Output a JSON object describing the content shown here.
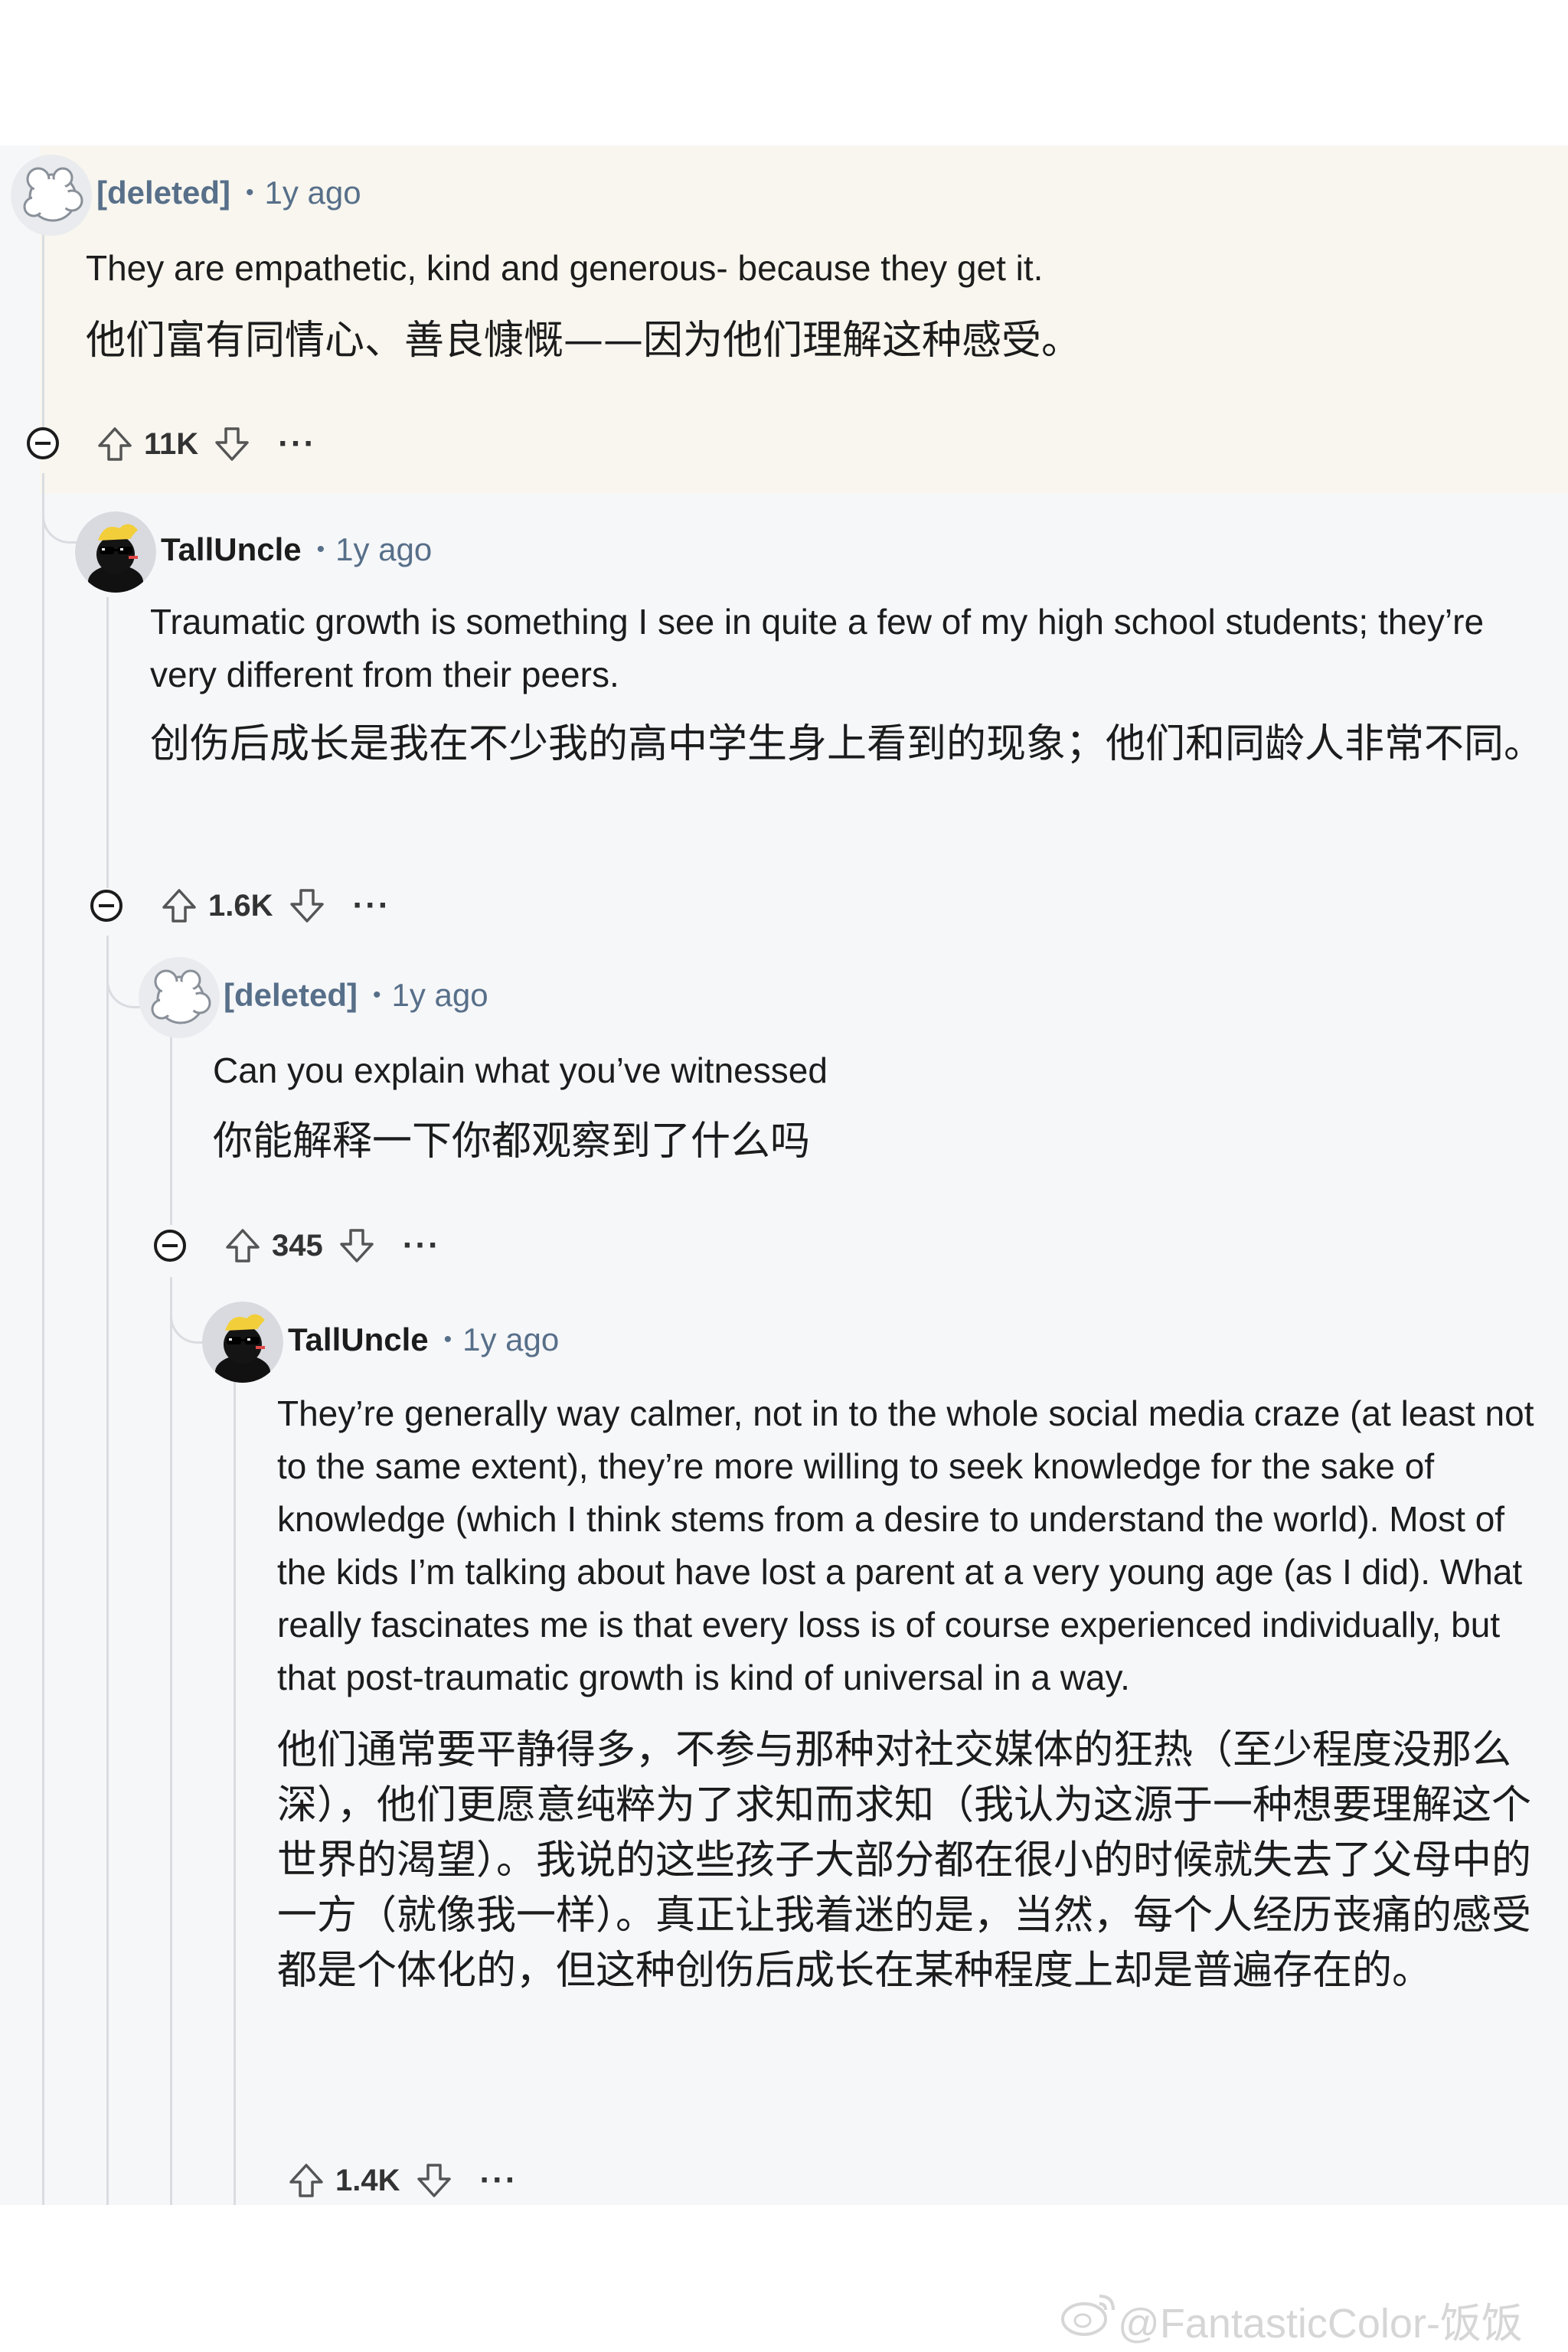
{
  "comments": [
    {
      "author": "[deleted]",
      "age": "1y ago",
      "text_en": "They are empathetic, kind and generous- because they get it.",
      "text_zh": "他们富有同情心、善良慷慨——因为他们理解这种感受。",
      "votes": "11K"
    },
    {
      "author": "TallUncle",
      "age": "1y ago",
      "text_en": "Traumatic growth is something I see in quite a few of my high school students; they’re very different from their peers.",
      "text_zh": "创伤后成长是我在不少我的高中学生身上看到的现象；他们和同龄人非常不同。",
      "votes": "1.6K"
    },
    {
      "author": "[deleted]",
      "age": "1y ago",
      "text_en": "Can you explain what you’ve witnessed",
      "text_zh": "你能解释一下你都观察到了什么吗",
      "votes": "345"
    },
    {
      "author": "TallUncle",
      "age": "1y ago",
      "text_en": "They’re generally way calmer, not in to the whole social media craze (at least not to the same extent), they’re more willing to seek knowledge for the sake of knowledge (which I think stems from a desire to understand the world). Most of the kids I’m talking about have lost a parent at a very young age (as I did). What really fascinates me is that every loss is of course experienced individually, but that post-traumatic growth is kind of universal in a way.",
      "text_zh": "他们通常要平静得多，不参与那种对社交媒体的狂热（至少程度没那么深），他们更愿意纯粹为了求知而求知（我认为这源于一种想要理解这个世界的渴望）。我说的这些孩子大部分都在很小的时候就失去了父母中的一方（就像我一样）。真正让我着迷的是，当然，每个人经历丧痛的感受都是个体化的，但这种创伤后成长在某种程度上却是普遍存在的。",
      "votes": "1.4K"
    }
  ],
  "more_label": "···",
  "watermark": "@FantasticColor-饭饭",
  "colors": {
    "thread_bg": "#f6f7f9",
    "highlight_bg": "#f8f6ef",
    "meta": "#576f89",
    "thread_line": "#d9dce0"
  },
  "icons": [
    "deleted-avatar-icon",
    "talluncle-avatar-icon",
    "upvote-arrow-icon",
    "downvote-arrow-icon",
    "collapse-minus-icon",
    "more-options-icon",
    "weibo-logo-icon"
  ]
}
